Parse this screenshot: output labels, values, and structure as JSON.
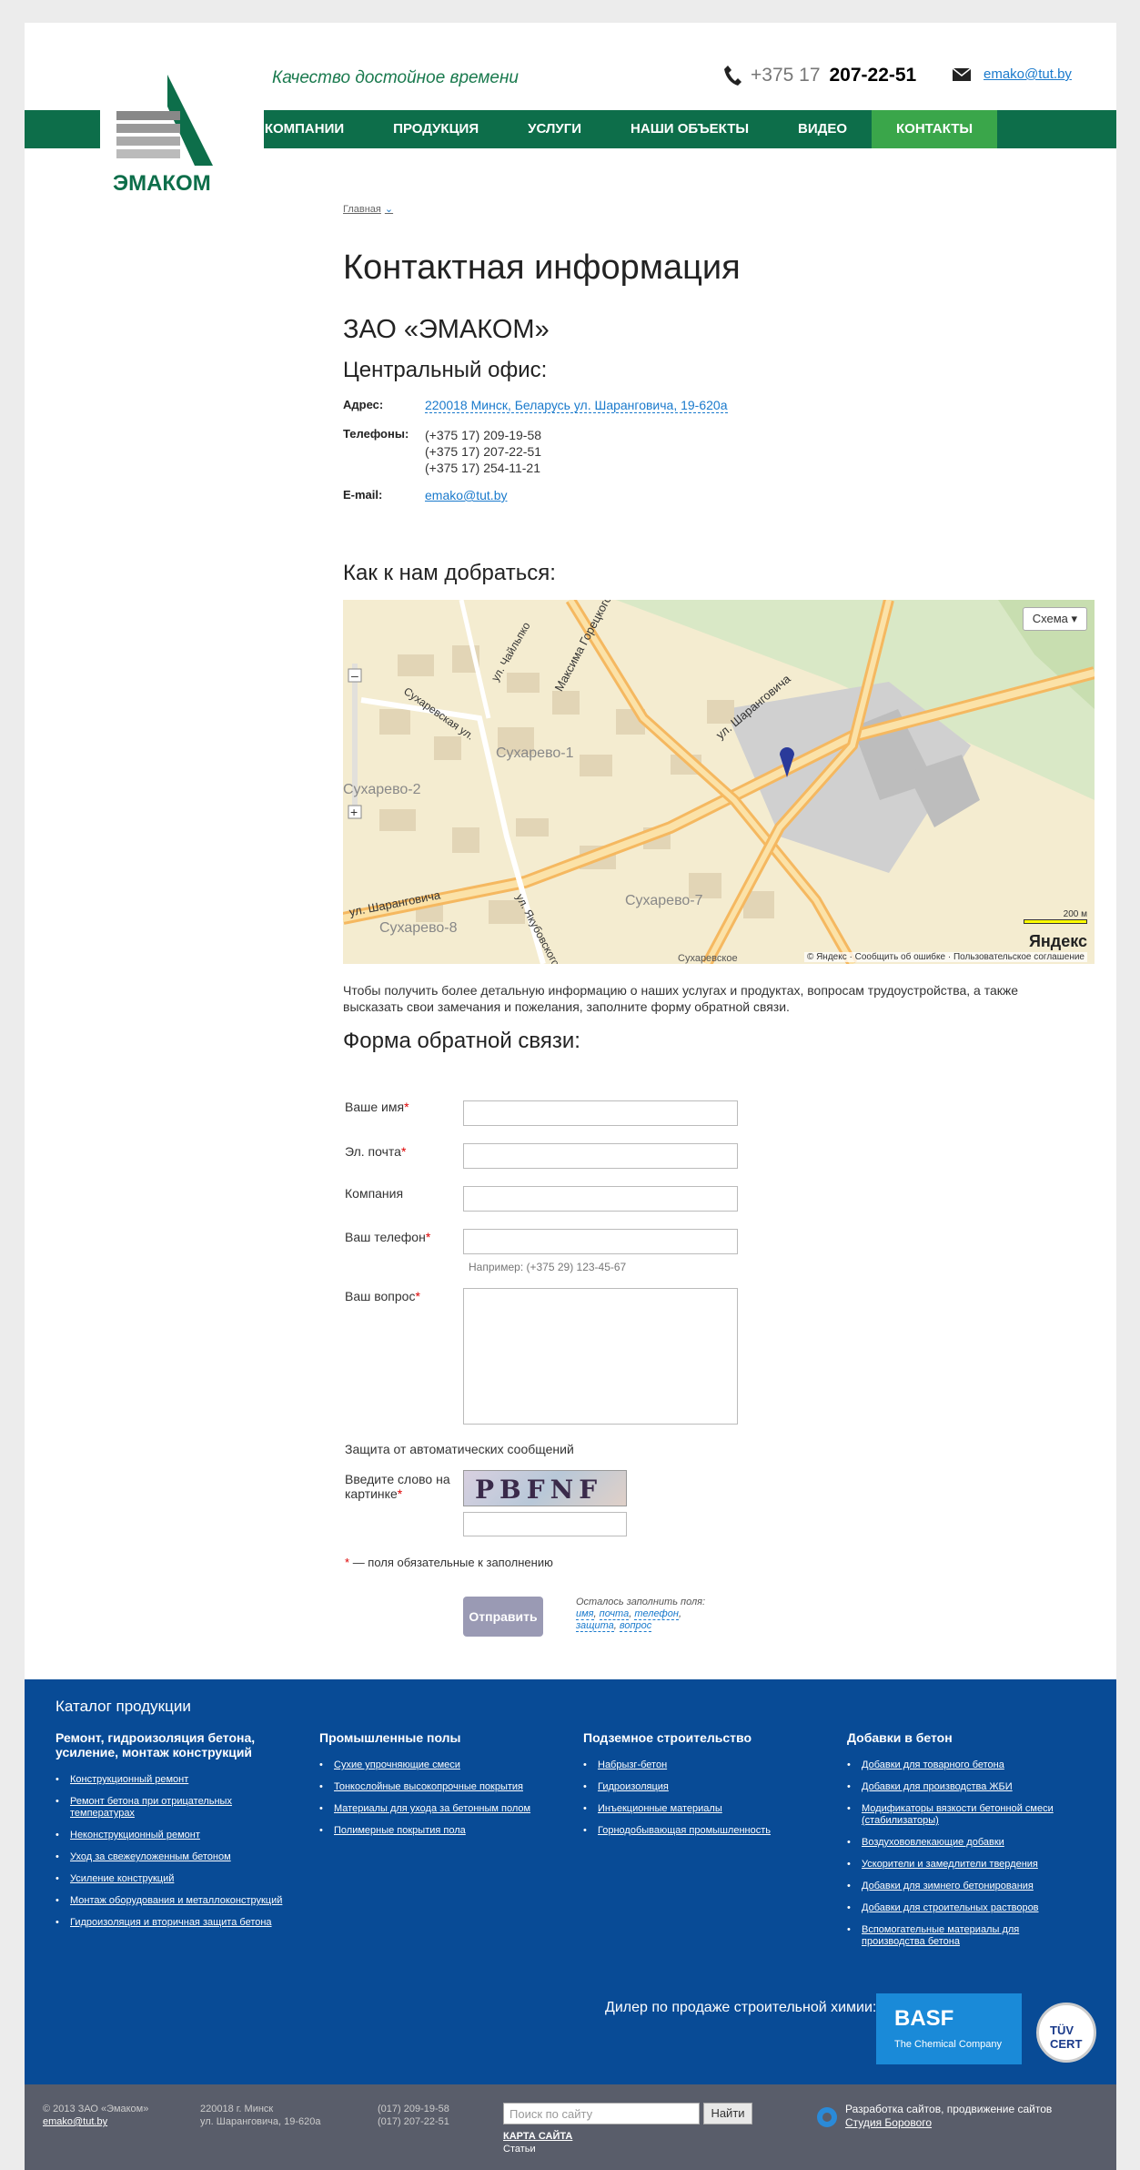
{
  "header": {
    "slogan": "Качество достойное времени",
    "phone_prefix": "+375 17",
    "phone_number": "207-22-51",
    "email": "emako@tut.by",
    "logo_text": "ЭМАКОМ"
  },
  "nav": [
    {
      "label": "О КОМПАНИИ"
    },
    {
      "label": "ПРОДУКЦИЯ"
    },
    {
      "label": "УСЛУГИ"
    },
    {
      "label": "НАШИ ОБЪЕКТЫ"
    },
    {
      "label": "ВИДЕО"
    },
    {
      "label": "КОНТАКТЫ",
      "active": true
    }
  ],
  "breadcrumb": "Главная",
  "page_title": "Контактная информация",
  "company": "ЗАО «ЭМАКОМ»",
  "office_title": "Центральный офис:",
  "contacts": {
    "address_label": "Адрес:",
    "address": "220018 Минск, Беларусь ул. Шаранговича, 19-620а",
    "phones_label": "Телефоны:",
    "phones": [
      "(+375 17) 209-19-58",
      "(+375 17) 207-22-51",
      "(+375 17) 254-11-21"
    ],
    "email_label": "E-mail:",
    "email": "emako@tut.by"
  },
  "how_title": "Как к нам добраться:",
  "map": {
    "mode": "Схема",
    "scale": "200 м",
    "brand": "Яндекс",
    "footer": "© Яндекс · Сообщить об ошибке · Пользовательское соглашение",
    "labels": [
      "Сухарево-1",
      "Сухарево-2",
      "Сухарево-7",
      "Сухарево-8",
      "ул. Шаранговича",
      "ул. Шаранговича",
      "Максима Горецкого",
      "Сухаревская ул.",
      "ул. Чайльпко",
      "ул. Якубовского",
      "Сухаревское"
    ]
  },
  "map_text": "Чтобы получить более детальную информацию о наших услугах и продуктах, вопросам трудоустройства, а также высказать свои замечания и пожелания, заполните форму обратной связи.",
  "form": {
    "title": "Форма обратной связи:",
    "name_label": "Ваше имя",
    "email_label": "Эл. почта",
    "company_label": "Компания",
    "phone_label": "Ваш телефон",
    "phone_hint": "Например: (+375 29) 123-45-67",
    "question_label": "Ваш вопрос",
    "protect": "Защита от автоматических сообщений",
    "captcha_label": "Введите слово на картинке",
    "captcha_word": "PBFNF",
    "required_note": "— поля обязательные к заполнению",
    "submit": "Отправить",
    "remain": "Осталось заполнить поля:",
    "remain_fields": [
      "имя",
      "почта",
      "телефон",
      "защита",
      "вопрос"
    ]
  },
  "footer": {
    "catalog_title": "Каталог продукции",
    "columns": [
      {
        "title": "Ремонт, гидроизоляция бетона, усиление, монтаж конструкций",
        "items": [
          "Конструкционный ремонт",
          "Ремонт бетона при отрицательных температурах",
          "Неконструкционный ремонт",
          "Уход за свежеуложенным бетоном",
          "Усиление конструкций",
          "Монтаж оборудования и металлоконструкций",
          "Гидроизоляция и вторичная защита бетона"
        ]
      },
      {
        "title": "Промышленные полы",
        "items": [
          "Сухие упрочняющие смеси",
          "Тонкослойные высокопрочные покрытия",
          "Материалы для ухода за бетонным полом",
          "Полимерные покрытия пола"
        ]
      },
      {
        "title": "Подземное строительство",
        "items": [
          "Набрызг-бетон",
          "Гидроизоляция",
          "Инъекционные материалы",
          "Горнодобывающая промышленность"
        ]
      },
      {
        "title": "Добавки в бетон",
        "items": [
          "Добавки для товарного бетона",
          "Добавки для производства ЖБИ",
          "Модификаторы вязкости бетонной смеси (стабилизаторы)",
          "Воздухововлекающие добавки",
          "Ускорители и замедлители твердения",
          "Добавки для зимнего бетонирования",
          "Добавки для строительных растворов",
          "Вспомогательные материалы для производства бетона"
        ]
      }
    ],
    "dealer": "Дилер по продаже строительной химии:",
    "basf_name": "BASF",
    "basf_sub": "The Chemical Company",
    "tuv_text": "TÜV CERT"
  },
  "bottom": {
    "copyright": "© 2013 ЗАО «Эмаком»",
    "email": "emako@tut.by",
    "address1": "220018 г. Минск",
    "address2": "ул. Шаранговича, 19-620а",
    "phone1": "(017) 209-19-58",
    "phone2": "(017) 207-22-51",
    "search_placeholder": "Поиск по сайту",
    "search_button": "Найти",
    "sitemap": "КАРТА САЙТА",
    "articles": "Статьи",
    "dev1": "Разработка сайтов, продвижение сайтов",
    "dev2": "Студия Борового"
  }
}
